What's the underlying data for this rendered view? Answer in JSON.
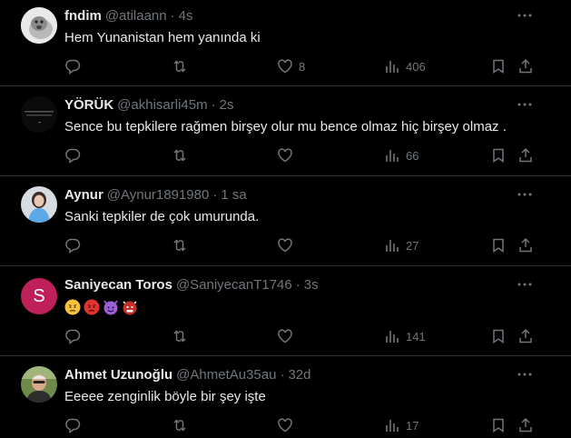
{
  "tweets": [
    {
      "name": "fndim",
      "handle": "@atilaann",
      "time": "4s",
      "text": "Hem Yunanistan hem yanında ki",
      "likes": "8",
      "views": "406",
      "avatar": "animal-photo"
    },
    {
      "name": "YÖRÜK",
      "handle": "@akhisarli45m",
      "time": "2s",
      "text": "Sence bu tepkilere rağmen birşey olur mu bence olmaz hiç birşey olmaz .",
      "likes": "",
      "views": "66",
      "avatar": "dark-text-image"
    },
    {
      "name": "Aynur",
      "handle": "@Aynur1891980",
      "time": "1 sa",
      "text": "Sanki tepkiler de çok umurunda.",
      "likes": "",
      "views": "27",
      "avatar": "woman-photo"
    },
    {
      "name": "Saniyecan Toros",
      "handle": "@SaniyecanT1746",
      "time": "3s",
      "text": "",
      "emojis": [
        "angry-face",
        "red-angry-face",
        "smiling-face-with-horns",
        "ogre"
      ],
      "likes": "",
      "views": "141",
      "avatar_letter": "S"
    },
    {
      "name": "Ahmet Uzunoğlu",
      "handle": "@AhmetAu35au",
      "time": "32d",
      "text": "Eeeee zenginlik böyle bir şey işte",
      "likes": "",
      "views": "17",
      "avatar": "man-photo"
    }
  ],
  "colors": {
    "background": "#000000",
    "text": "#e7e9ea",
    "muted": "#71767b",
    "divider": "#2f3336",
    "avatar_s": "#c0205a"
  }
}
